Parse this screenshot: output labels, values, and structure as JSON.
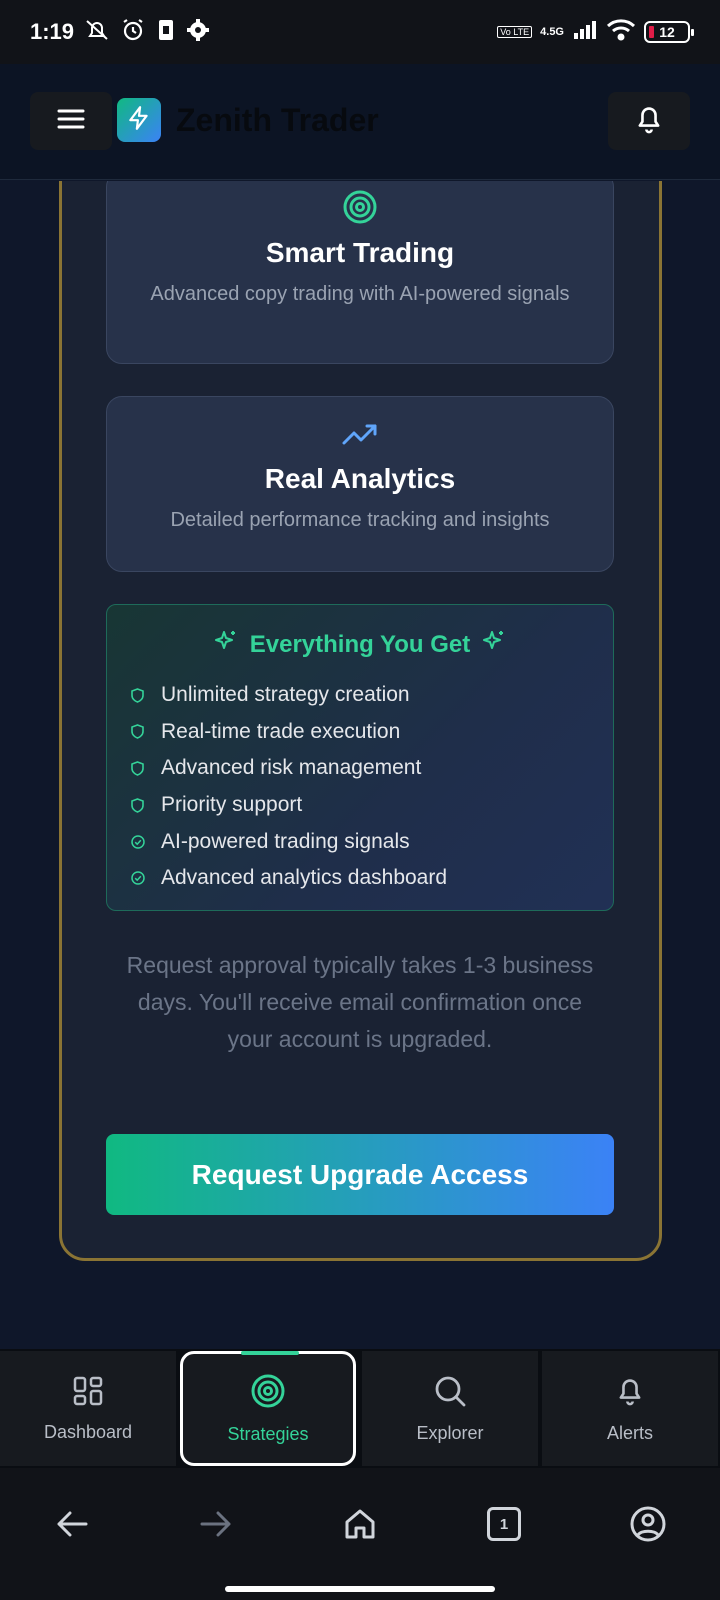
{
  "status_bar": {
    "time": "1:19",
    "network_label": "4.5G",
    "volte_label": "Vo LTE",
    "battery_level": "12"
  },
  "header": {
    "app_title": "Zenith Trader"
  },
  "features": [
    {
      "title": "Smart Trading",
      "description": "Advanced copy trading with AI-powered signals",
      "icon": "target-icon",
      "icon_color": "#34d399"
    },
    {
      "title": "Real Analytics",
      "description": "Detailed performance tracking and insights",
      "icon": "trending-up-icon",
      "icon_color": "#60a5fa"
    }
  ],
  "everything": {
    "heading": "Everything You Get",
    "items": [
      {
        "label": "Unlimited strategy creation",
        "icon": "shield-icon"
      },
      {
        "label": "Real-time trade execution",
        "icon": "shield-icon"
      },
      {
        "label": "Advanced risk management",
        "icon": "shield-icon"
      },
      {
        "label": "Priority support",
        "icon": "shield-icon"
      },
      {
        "label": "AI-powered trading signals",
        "icon": "check-circle-icon"
      },
      {
        "label": "Advanced analytics dashboard",
        "icon": "check-circle-icon"
      }
    ]
  },
  "note": "Request approval typically takes 1-3 business days. You'll receive email confirmation once your account is upgraded.",
  "cta_label": "Request Upgrade Access",
  "bottom_nav": [
    {
      "label": "Dashboard",
      "icon": "grid-icon"
    },
    {
      "label": "Strategies",
      "icon": "target-icon",
      "active": true
    },
    {
      "label": "Explorer",
      "icon": "search-icon"
    },
    {
      "label": "Alerts",
      "icon": "bell-icon"
    }
  ],
  "browser": {
    "tab_count": "1"
  },
  "colors": {
    "accent_green": "#34d399",
    "accent_blue": "#3b82f6",
    "card_border_gold": "#8a7434"
  }
}
